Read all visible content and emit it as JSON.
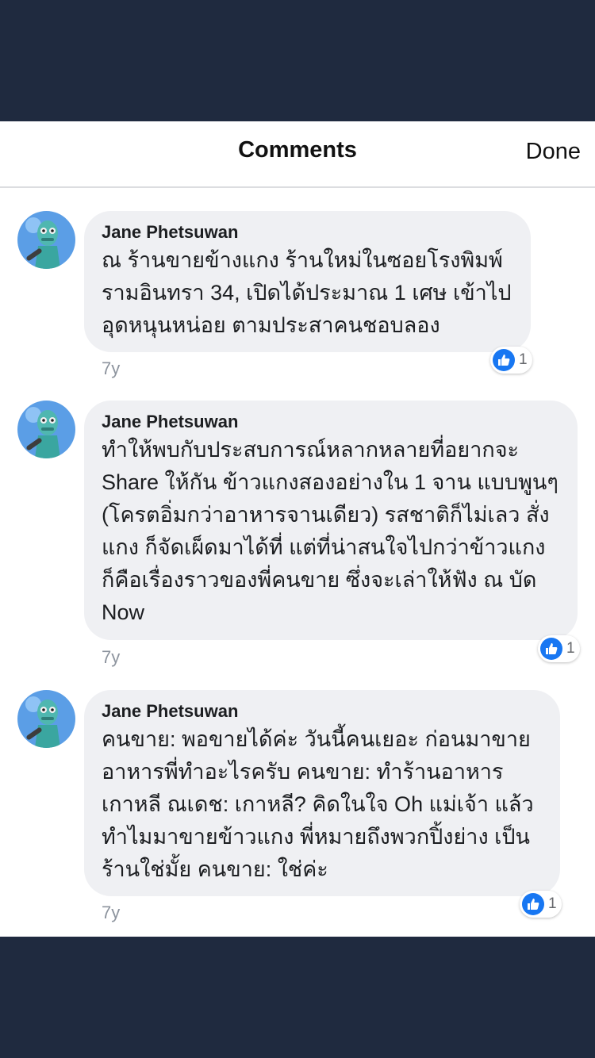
{
  "header": {
    "title": "Comments",
    "done_label": "Done"
  },
  "comments": [
    {
      "author": "Jane Phetsuwan",
      "text": "ณ ร้านขายข้างแกง ร้านใหม่ในซอยโรงพิมพ์ รามอินทรา 34, เปิดได้ประมาณ 1 เศษ เข้าไปอุดหนุนหน่อย ตามประสาคนชอบลอง",
      "age": "7y",
      "likes": "1"
    },
    {
      "author": "Jane Phetsuwan",
      "text": "ทำให้พบกับประสบการณ์หลากหลายที่อยากจะ Share ให้กัน ข้าวแกงสองอย่างใน 1 จาน แบบพูนๆ (โครตอิ่มกว่าอาหารจานเดียว) รสชาติก็ไม่เลว สั่งแกง ก็จัดเผ็ดมาได้ที่ แต่ที่น่าสนใจไปกว่าข้าวแกง ก็คือเรื่องราวของพี่คนขาย ซึ่งจะเล่าให้ฟัง ณ บัด Now",
      "age": "7y",
      "likes": "1"
    },
    {
      "author": "Jane Phetsuwan",
      "text": "คนขาย: พอขายได้ค่ะ วันนี้คนเยอะ ก่อนมาขายอาหารพี่ทำอะไรครับ คนขาย: ทำร้านอาหารเกาหลี ณเดช: เกาหลี? คิดในใจ Oh แม่เจ้า แล้วทำไมมาขายข้าวแกง พี่หมายถึงพวกปิ้งย่าง เป็นร้านใช่มั้ย คนขาย: ใช่ค่ะ",
      "age": "7y",
      "likes": "1"
    }
  ]
}
